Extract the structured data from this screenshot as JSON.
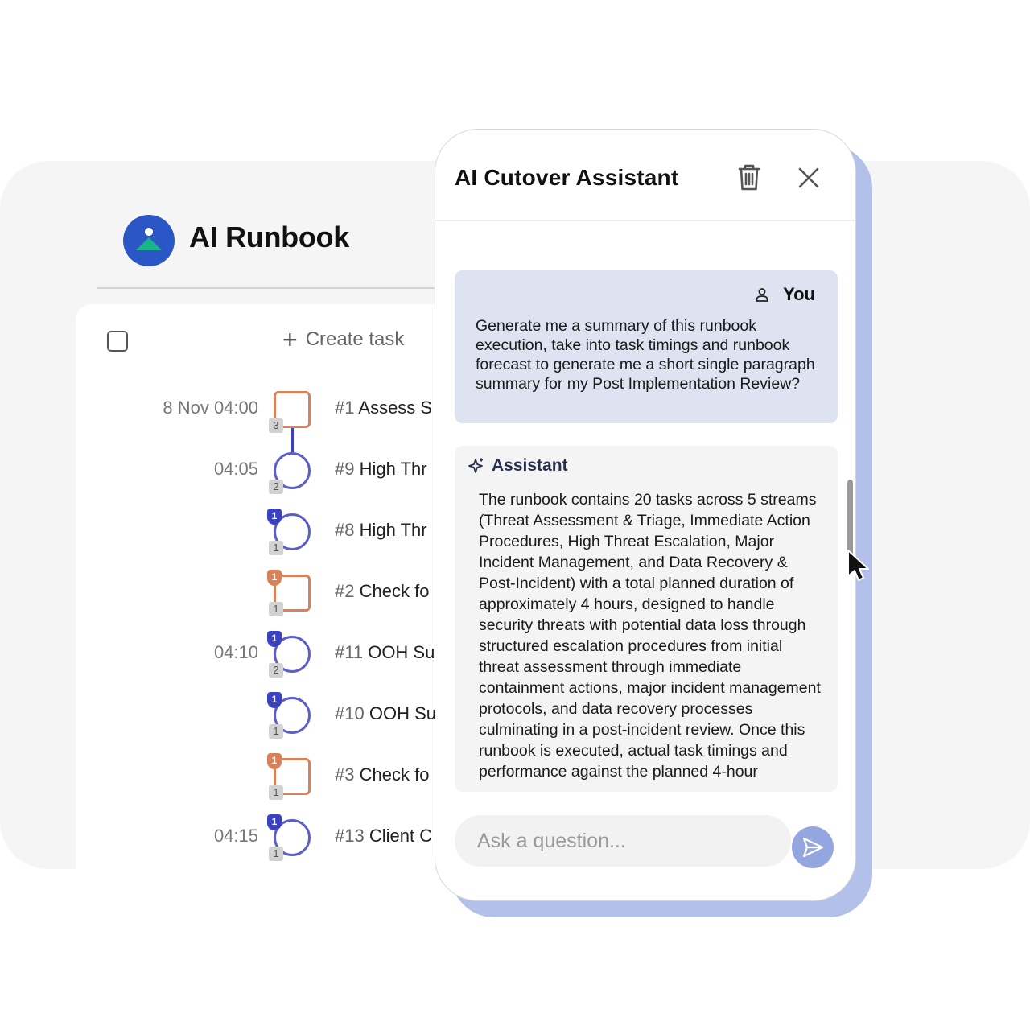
{
  "runbook": {
    "title": "AI Runbook",
    "create_task_label": "Create task",
    "tasks": [
      {
        "time": "8 Nov 04:00",
        "num": "#1",
        "name": "Assess S",
        "shape": "square",
        "pred": "",
        "succ": "3"
      },
      {
        "time": "04:05",
        "num": "#9",
        "name": "High Thr",
        "shape": "circle",
        "pred": "",
        "succ": "2"
      },
      {
        "time": "",
        "num": "#8",
        "name": "High Thr",
        "shape": "circle",
        "pred": "1",
        "succ": "1"
      },
      {
        "time": "",
        "num": "#2",
        "name": "Check fo",
        "shape": "square",
        "pred": "1",
        "succ": "1"
      },
      {
        "time": "04:10",
        "num": "#11",
        "name": "OOH Su",
        "shape": "circle",
        "pred": "1",
        "succ": "2"
      },
      {
        "time": "",
        "num": "#10",
        "name": "OOH Su",
        "shape": "circle",
        "pred": "1",
        "succ": "1"
      },
      {
        "time": "",
        "num": "#3",
        "name": "Check fo",
        "shape": "square",
        "pred": "1",
        "succ": "1"
      },
      {
        "time": "04:15",
        "num": "#13",
        "name": "Client C",
        "shape": "circle",
        "pred": "1",
        "succ": "1"
      }
    ]
  },
  "assistant": {
    "title": "AI Cutover Assistant",
    "user_name": "You",
    "user_message": "Generate me a summary of this runbook execution, take into task timings and runbook forecast to generate me a short single paragraph summary for my Post Implementation Review?",
    "assistant_name": "Assistant",
    "assistant_message": "The runbook contains 20 tasks across 5 streams (Threat Assessment & Triage, Immediate Action Procedures, High Threat Escalation, Major Incident Management, and Data Recovery & Post-Incident) with a total planned duration of approximately 4 hours, designed to handle security threats with potential data loss through structured escalation procedures from initial threat assessment through immediate containment actions, major incident management protocols, and data recovery processes culminating in a post-incident review. Once this runbook is executed, actual task timings and performance against the planned 4-hour",
    "input_placeholder": "Ask a question..."
  },
  "colors": {
    "brand_blue": "#2a56c6",
    "logo_green": "#19b38a",
    "node_blue": "#5b5fc7",
    "node_orange": "#d9825a",
    "user_bubble": "#dde3f1",
    "send_button": "#93a6e0",
    "panel_shadow": "#b3c0ea"
  },
  "icons": {
    "logo": "runbook-logo-icon",
    "plus": "plus-icon",
    "trash": "trash-icon",
    "close": "close-icon",
    "user": "user-icon",
    "sparkle": "sparkle-icon",
    "send": "send-icon",
    "cursor": "mouse-pointer-icon"
  }
}
